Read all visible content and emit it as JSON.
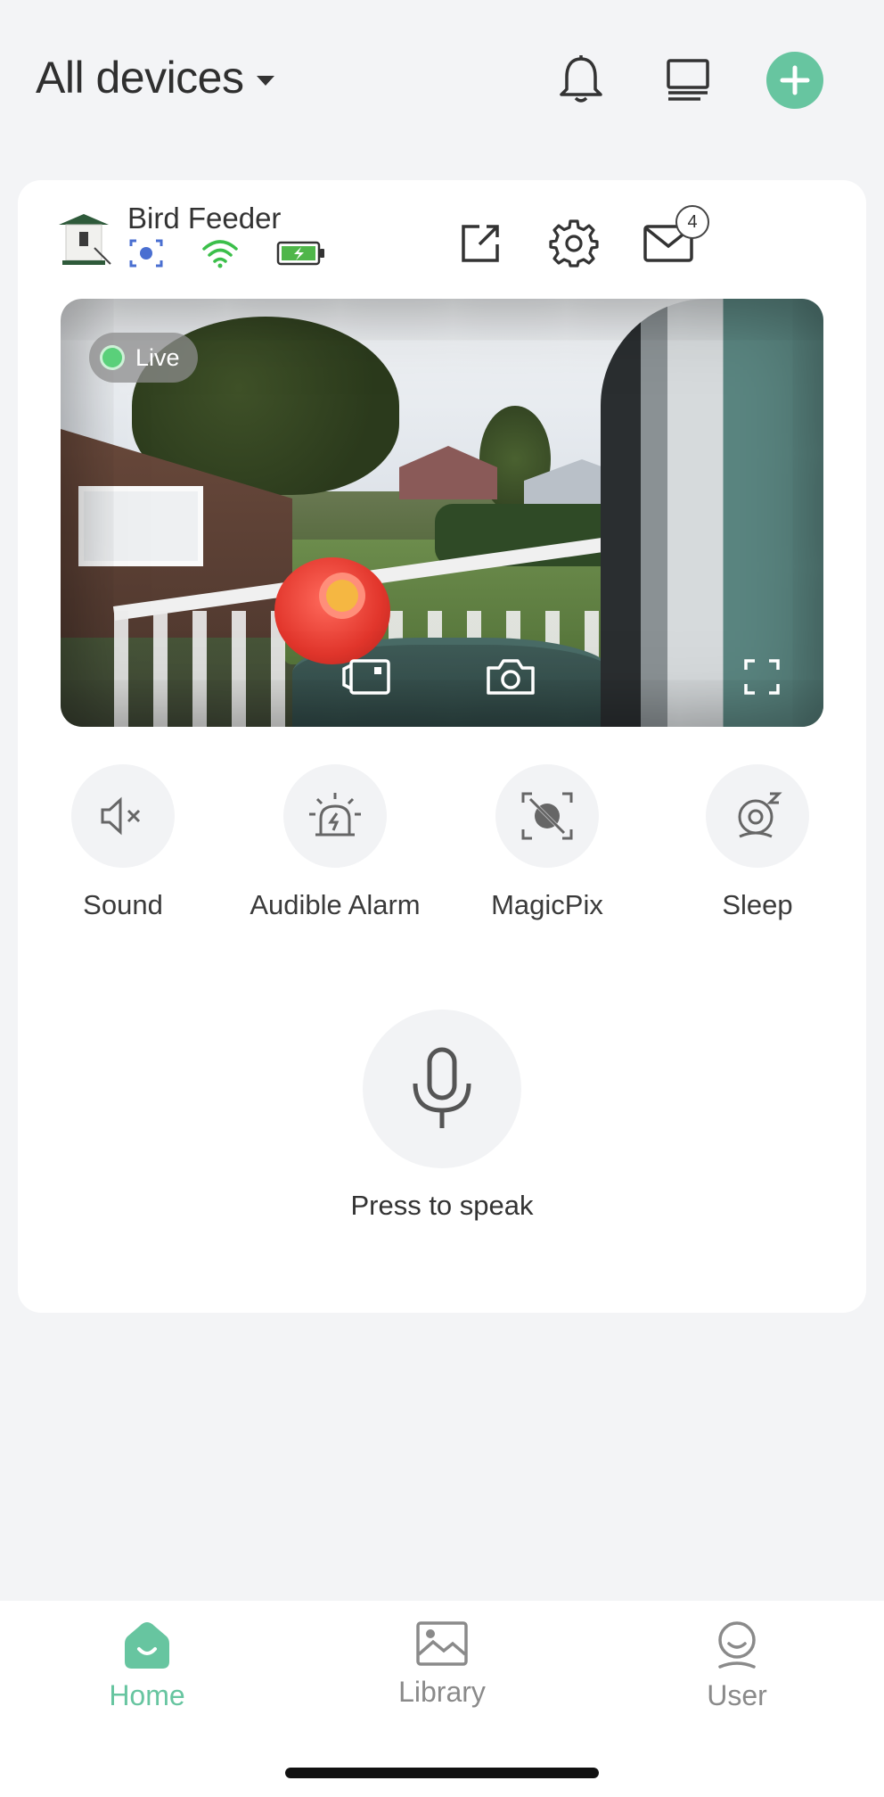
{
  "header": {
    "title": "All devices",
    "icons": [
      "bell-icon",
      "devices-list-icon",
      "plus-icon"
    ]
  },
  "device": {
    "name": "Bird Feeder",
    "status_icons": [
      "detection-icon",
      "wifi-icon",
      "battery-charging-icon"
    ],
    "mail_badge": "4",
    "actions": [
      "share-icon",
      "gear-icon",
      "mail-icon"
    ]
  },
  "camera": {
    "live_label": "Live",
    "buttons": [
      "record-icon",
      "snapshot-icon",
      "fullscreen-icon"
    ]
  },
  "controls": [
    {
      "label": "Sound",
      "icon": "speaker-muted-icon"
    },
    {
      "label": "Audible Alarm",
      "icon": "alarm-icon"
    },
    {
      "label": "MagicPix",
      "icon": "magicpix-icon"
    },
    {
      "label": "Sleep",
      "icon": "sleep-icon"
    }
  ],
  "speak": {
    "label": "Press to speak",
    "icon": "microphone-icon"
  },
  "nav": {
    "items": [
      {
        "label": "Home",
        "active": true
      },
      {
        "label": "Library",
        "active": false
      },
      {
        "label": "User",
        "active": false
      }
    ]
  },
  "colors": {
    "accent": "#67c5a0",
    "wifi": "#3bbf4a",
    "battery": "#4fb64a",
    "detection": "#4a6fd1",
    "inactive": "#8a8a8a"
  }
}
